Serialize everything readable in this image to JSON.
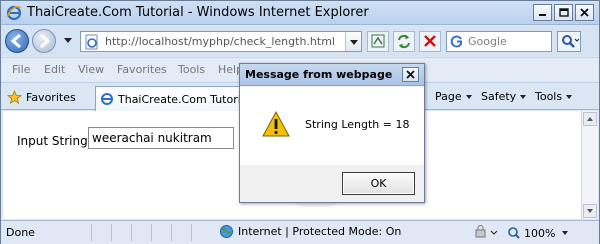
{
  "window": {
    "title": "ThaiCreate.Com Tutorial - Windows Internet Explorer",
    "controls": [
      "minimize-icon",
      "maximize-icon",
      "close-icon"
    ]
  },
  "address_bar": {
    "url": "http://localhost/myphp/check_length.html"
  },
  "search": {
    "placeholder": "Google"
  },
  "menu": {
    "items": [
      "File",
      "Edit",
      "View",
      "Favorites",
      "Tools",
      "Help"
    ]
  },
  "favorites_bar": {
    "favorites_label": "Favorites",
    "tab_label": "ThaiCreate.Com Tutorial",
    "commands": [
      "Page",
      "Safety",
      "Tools"
    ]
  },
  "content": {
    "input_label": "Input String",
    "input_value": "weerachai nukitram"
  },
  "status_bar": {
    "status": "Done",
    "zone": "Internet | Protected Mode: On",
    "zoom": "100%"
  },
  "dialog": {
    "title": "Message from webpage",
    "message": "String Length = 18",
    "ok_label": "OK",
    "icon": "warning-icon"
  },
  "colors": {
    "chrome": "#dce7f5",
    "titlebar": "#b9d1ee",
    "warning": "#f2c200"
  }
}
